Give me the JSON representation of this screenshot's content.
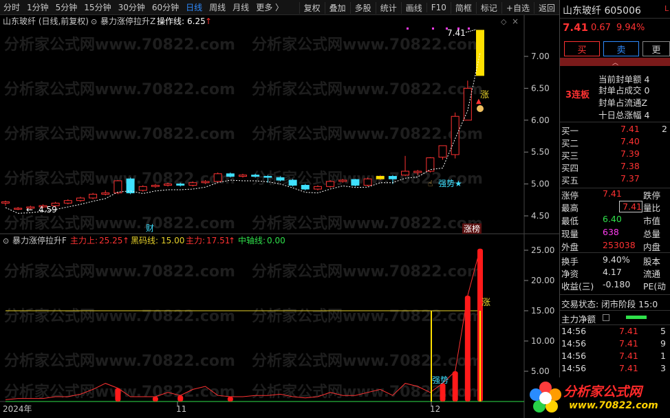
{
  "toolbar": {
    "periods": [
      "分时",
      "1分钟",
      "5分钟",
      "15分钟",
      "30分钟",
      "60分钟",
      "日线",
      "周线",
      "月线",
      "更多 〉"
    ],
    "active_period": "日线",
    "tools": [
      "复权",
      "叠加",
      "多股",
      "统计",
      "画线",
      "F10",
      "简框",
      "标记",
      "+自选",
      "返回"
    ]
  },
  "main": {
    "title": "山东玻纤 (日线,前复权)",
    "indicator": "暴力涨停拉升Z",
    "op_line_label": "操作线:",
    "op_line_value": "6.25",
    "op_line_arrow": "↑",
    "y_ticks": [
      "7.00",
      "6.50",
      "6.00",
      "5.50",
      "5.00",
      "4.50"
    ],
    "high_label": "7.41",
    "low_label": "4.59",
    "marker_zhang": "涨",
    "marker_strong": "强势★",
    "marker_cai": "财",
    "marker_zhangbang": "涨榜"
  },
  "sub": {
    "indicator": "暴力涨停拉升F",
    "main_up_label": "主力上:",
    "main_up_value": "25.25",
    "main_up_arrow": "↑",
    "black_horse_label": "黑码线:",
    "black_horse_value": "15.00",
    "main_label": "主力:",
    "main_value": "17.51",
    "main_arrow": "↑",
    "axis_label": "中轴线:",
    "axis_value": "0.00",
    "y_ticks": [
      "25.00",
      "20.00",
      "15.00",
      "10.00",
      "5.00"
    ],
    "marker_strong": "强势",
    "marker_zhang": "涨"
  },
  "x_axis": {
    "labels": [
      "2024年",
      "11",
      "12"
    ]
  },
  "watermark": "分析家公式网www.70822.com",
  "panel": {
    "name": "山东玻纤 605006",
    "flag": "L",
    "price": "7.41",
    "change": "0.67",
    "change_pct": "9.94%",
    "buy_label": "买",
    "sell_label": "卖",
    "more_label": "更",
    "limit_tag": "3连板",
    "limit_rows": [
      "当前封单额 4",
      "封单占成交 0",
      "封单占流通Z",
      "十日总涨幅 4"
    ],
    "bids": [
      {
        "label": "买一",
        "price": "7.41",
        "vol": "2"
      },
      {
        "label": "买二",
        "price": "7.40",
        "vol": ""
      },
      {
        "label": "买三",
        "price": "7.39",
        "vol": ""
      },
      {
        "label": "买四",
        "price": "7.38",
        "vol": ""
      },
      {
        "label": "买五",
        "price": "7.37",
        "vol": ""
      }
    ],
    "stats": [
      {
        "label": "涨停",
        "value": "7.41",
        "tail": "跌停"
      },
      {
        "label": "最高",
        "value": "7.41",
        "tail": "量比"
      },
      {
        "label": "最低",
        "value": "6.40",
        "tail": "市值"
      },
      {
        "label": "现量",
        "value": "638",
        "tail": "总量"
      },
      {
        "label": "外盘",
        "value": "253038",
        "tail": "内盘"
      }
    ],
    "stats2": [
      {
        "label": "换手",
        "value": "9.40%",
        "tail": "股本"
      },
      {
        "label": "净资",
        "value": "4.17",
        "tail": "流通"
      },
      {
        "label": "收益(三)",
        "value": "-0.180",
        "tail": "PE(动"
      }
    ],
    "trade_state": "交易状态: 闭市阶段 15:0",
    "main_net": "主力净额",
    "ticks": [
      {
        "time": "14:56",
        "price": "7.41",
        "vol": "5"
      },
      {
        "time": "14:56",
        "price": "7.41",
        "vol": "9"
      },
      {
        "time": "14:56",
        "price": "7.41",
        "vol": "1"
      },
      {
        "time": "14:56",
        "price": "7.41",
        "vol": "3"
      }
    ]
  },
  "logo": {
    "brand": "分析家公式网",
    "url": "www.70822.com"
  },
  "chart_data": {
    "type": "candlestick",
    "x_labels": [
      "2024年",
      "11",
      "12"
    ],
    "price_ticks": [
      4.5,
      5.0,
      5.5,
      6.0,
      6.5,
      7.0
    ],
    "candles": [
      [
        4.7,
        4.72,
        4.66,
        4.74
      ],
      [
        4.62,
        4.62,
        4.59,
        4.64
      ],
      [
        4.62,
        4.64,
        4.6,
        4.66
      ],
      [
        4.64,
        4.66,
        4.62,
        4.68
      ],
      [
        4.66,
        4.7,
        4.64,
        4.72
      ],
      [
        4.7,
        4.74,
        4.68,
        4.76
      ],
      [
        4.74,
        4.78,
        4.72,
        4.8
      ],
      [
        4.78,
        4.84,
        4.76,
        4.86
      ],
      [
        4.84,
        4.86,
        4.82,
        4.9
      ],
      [
        4.86,
        5.05,
        4.84,
        5.06
      ],
      [
        5.08,
        4.86,
        4.84,
        5.1
      ],
      [
        4.9,
        4.96,
        4.88,
        4.98
      ],
      [
        4.96,
        4.98,
        4.94,
        5.0
      ],
      [
        4.98,
        5.0,
        4.96,
        5.02
      ],
      [
        5.0,
        4.98,
        4.96,
        5.02
      ],
      [
        4.98,
        5.02,
        4.96,
        5.04
      ],
      [
        5.02,
        5.04,
        5.0,
        5.06
      ],
      [
        5.04,
        5.16,
        5.02,
        5.18
      ],
      [
        5.16,
        5.12,
        5.1,
        5.18
      ],
      [
        5.12,
        5.14,
        5.1,
        5.16
      ],
      [
        5.14,
        5.12,
        5.1,
        5.16
      ],
      [
        5.12,
        5.11,
        5.02,
        5.14
      ],
      [
        5.1,
        5.06,
        5.04,
        5.12
      ],
      [
        5.06,
        4.98,
        4.96,
        5.08
      ],
      [
        4.98,
        4.92,
        4.9,
        5.0
      ],
      [
        4.92,
        4.96,
        4.9,
        4.98
      ],
      [
        4.96,
        5.04,
        4.94,
        5.06
      ],
      [
        5.04,
        5.06,
        5.02,
        5.08
      ],
      [
        5.07,
        4.98,
        4.96,
        5.08
      ],
      [
        4.98,
        5.08,
        4.96,
        5.1
      ],
      [
        5.08,
        5.12,
        5.06,
        5.14
      ],
      [
        5.12,
        5.08,
        5.0,
        5.14
      ],
      [
        5.14,
        5.2,
        5.12,
        5.44
      ],
      [
        5.18,
        5.2,
        5.14,
        5.22
      ],
      [
        5.2,
        5.41,
        5.18,
        5.42
      ],
      [
        5.42,
        5.6,
        5.38,
        5.6
      ],
      [
        5.46,
        6.06,
        5.4,
        6.12
      ],
      [
        6.0,
        6.5,
        6.0,
        6.62
      ],
      [
        6.7,
        7.41,
        6.7,
        7.41
      ]
    ],
    "volume": [
      0.3,
      0.5,
      0.5,
      0.5,
      0.8,
      0.8,
      1.2,
      2.0,
      3.0,
      2.2,
      0.8,
      0.8,
      0.8,
      1.5,
      1.0,
      2.0,
      2.5,
      1.0,
      0.8,
      0.8,
      1.0,
      1.0,
      1.2,
      0.8,
      0.6,
      0.8,
      1.5,
      1.0,
      1.0,
      1.5,
      2.0,
      1.0,
      3.0,
      2.5,
      1.5,
      3.0,
      5.0,
      17.5,
      25.25
    ],
    "black_horse_line": 15.0,
    "sub_ticks": [
      5,
      10,
      15,
      20,
      25
    ]
  }
}
